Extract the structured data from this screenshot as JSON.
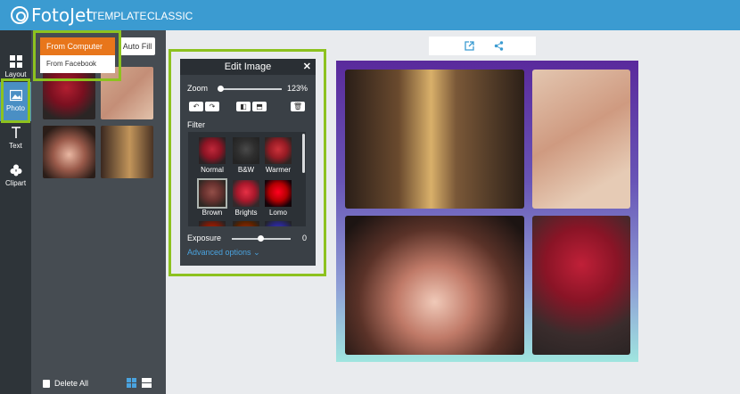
{
  "header": {
    "logo_text": "FotoJet",
    "nav": [
      "TEMPLATE",
      "CLASSIC"
    ]
  },
  "leftnav": {
    "items": [
      {
        "label": "Layout",
        "icon": "layout-icon"
      },
      {
        "label": "Photo",
        "icon": "photo-icon",
        "active": true
      },
      {
        "label": "Text",
        "icon": "text-icon"
      },
      {
        "label": "Clipart",
        "icon": "clipart-icon"
      }
    ]
  },
  "photo_panel": {
    "dropdown": [
      "From Computer",
      "From Facebook"
    ],
    "auto_fill": "Auto Fill",
    "delete_all": "Delete All"
  },
  "edit_image": {
    "title": "Edit Image",
    "close": "✕",
    "zoom_label": "Zoom",
    "zoom_value": "123%",
    "filter_label": "Filter",
    "filters": [
      "Normal",
      "B&W",
      "Warmer",
      "Brown",
      "Brights",
      "Lomo"
    ],
    "selected_filter": "Brown",
    "exposure_label": "Exposure",
    "exposure_value": "0",
    "advanced": "Advanced options"
  },
  "colors": {
    "accent": "#3b9bd1",
    "highlight": "#8dc21f",
    "dropdown_active": "#e8761b"
  }
}
